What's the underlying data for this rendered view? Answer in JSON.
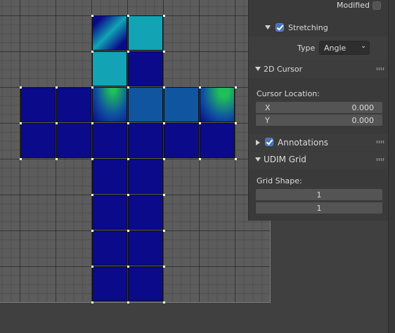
{
  "header": {
    "modified_label": "Modified",
    "modified_checked": false
  },
  "stretching": {
    "label": "Stretching",
    "checked": true,
    "type_label": "Type",
    "type_value": "Angle"
  },
  "cursor_panel": {
    "title": "2D Cursor",
    "location_label": "Cursor Location:",
    "x_label": "X",
    "x_value": "0.000",
    "y_label": "Y",
    "y_value": "0.000"
  },
  "annotations": {
    "label": "Annotations",
    "checked": true
  },
  "udim_panel": {
    "title": "UDIM Grid",
    "shape_label": "Grid Shape:",
    "shape_x": "1",
    "shape_y": "1"
  },
  "colors": {
    "uv_dark_blue": "#0a0a8a",
    "uv_mid_blue": "#0f55a0",
    "uv_cyan": "#12a4b4",
    "uv_green": "#1fbf5a",
    "accent_checkbox": "#4772b3"
  }
}
